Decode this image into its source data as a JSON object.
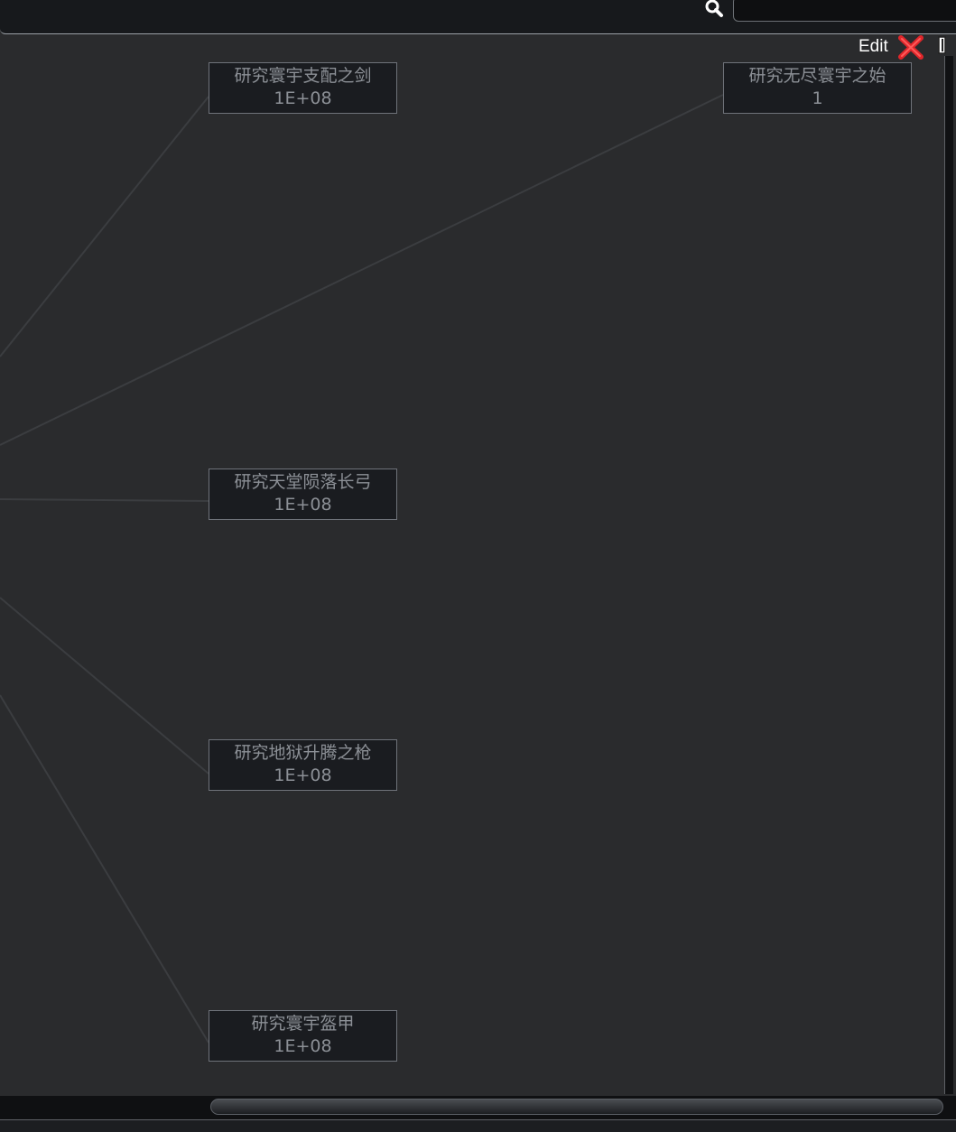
{
  "header": {
    "search_placeholder": "",
    "search_value": ""
  },
  "toolbar": {
    "edit_label": "Edit"
  },
  "nodes": [
    {
      "title": "研究寰宇支配之剑",
      "value": "1E+08"
    },
    {
      "title": "研究无尽寰宇之始",
      "value": "1"
    },
    {
      "title": "研究天堂陨落长弓",
      "value": "1E+08"
    },
    {
      "title": "研究地狱升腾之枪",
      "value": "1E+08"
    },
    {
      "title": "研究寰宇盔甲",
      "value": "1E+08"
    }
  ],
  "colors": {
    "background": "#2a2b2d",
    "node_bg": "#1a1c20",
    "node_border": "#6f737a",
    "node_text": "#8c9096",
    "connector": "#3b3d40",
    "close_red": "#e0262a"
  }
}
